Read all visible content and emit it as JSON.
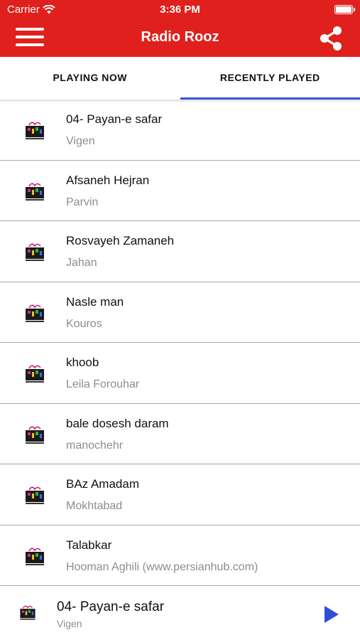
{
  "status_bar": {
    "carrier": "Carrier",
    "time": "3:36 PM"
  },
  "header": {
    "title": "Radio Rooz",
    "menu_icon": "hamburger-menu-icon",
    "share_icon": "share-icon"
  },
  "tabs": [
    {
      "label": "PLAYING NOW",
      "active": false
    },
    {
      "label": "RECENTLY PLAYED",
      "active": true
    }
  ],
  "recently_played": [
    {
      "song": "04- Payan-e safar",
      "artist": "Vigen"
    },
    {
      "song": "Afsaneh Hejran",
      "artist": "Parvin"
    },
    {
      "song": "Rosvayeh Zamaneh",
      "artist": "Jahan"
    },
    {
      "song": "Nasle man",
      "artist": "Kouros"
    },
    {
      "song": "khoob",
      "artist": "Leila Forouhar"
    },
    {
      "song": "bale dosesh daram",
      "artist": "manochehr"
    },
    {
      "song": "BAz Amadam",
      "artist": "Mokhtabad"
    },
    {
      "song": "Talabkar",
      "artist": "Hooman Aghili (www.persianhub.com)"
    }
  ],
  "now_playing": {
    "song": "04- Payan-e safar",
    "artist": "Vigen",
    "play_icon": "play-icon"
  },
  "colors": {
    "header_red": "#e0201c",
    "tab_indicator": "#3b55d4",
    "play_button": "#2f4fd6",
    "secondary_text": "#8d8d8d"
  }
}
